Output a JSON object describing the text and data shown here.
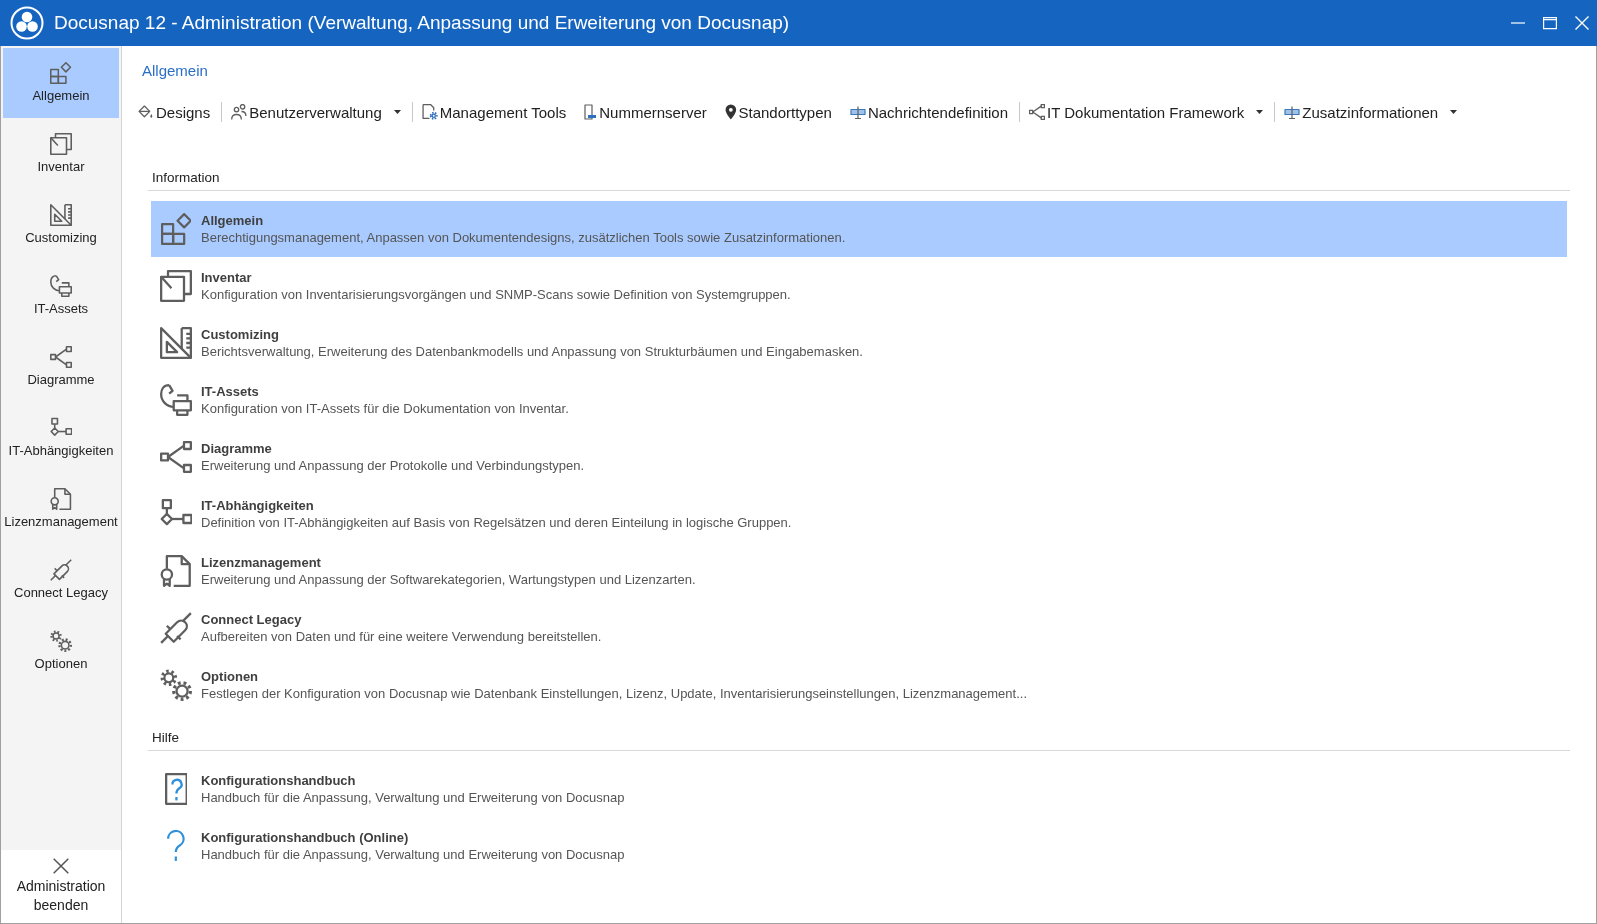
{
  "window": {
    "title": "Docusnap 12 - Administration (Verwaltung, Anpassung und Erweiterung von Docusnap)"
  },
  "sidebar": {
    "items": [
      {
        "label": "Allgemein",
        "kind": "tiles",
        "selected": true
      },
      {
        "label": "Inventar",
        "kind": "documents",
        "selected": false
      },
      {
        "label": "Customizing",
        "kind": "setsquare",
        "selected": false
      },
      {
        "label": "IT-Assets",
        "kind": "assets",
        "selected": false
      },
      {
        "label": "Diagramme",
        "kind": "diagram",
        "selected": false
      },
      {
        "label": "IT-Abhängigkeiten",
        "kind": "flowchart",
        "selected": false
      },
      {
        "label": "Lizenzmanagement",
        "kind": "certificate",
        "selected": false
      },
      {
        "label": "Connect Legacy",
        "kind": "plug",
        "selected": false
      },
      {
        "label": "Optionen",
        "kind": "gears",
        "selected": false
      }
    ],
    "exit": {
      "label": "Administration beenden"
    }
  },
  "page_title": "Allgemein",
  "toolbar": {
    "groups": [
      {
        "items": [
          {
            "label": "Designs",
            "kind": "bucket",
            "dropdown": false
          }
        ]
      },
      {
        "items": [
          {
            "label": "Benutzerverwaltung",
            "kind": "users",
            "dropdown": true
          }
        ]
      },
      {
        "items": [
          {
            "label": "Management Tools",
            "kind": "docgear",
            "dropdown": false
          },
          {
            "label": "Nummernserver",
            "kind": "numbers",
            "dropdown": false
          },
          {
            "label": "Standorttypen",
            "kind": "pin",
            "dropdown": false
          },
          {
            "label": "Nachrichtendefinition",
            "kind": "form",
            "dropdown": false
          }
        ]
      },
      {
        "items": [
          {
            "label": "IT Dokumentation Framework",
            "kind": "share",
            "dropdown": true
          }
        ]
      },
      {
        "items": [
          {
            "label": "Zusatzinformationen",
            "kind": "form",
            "dropdown": true
          }
        ]
      }
    ]
  },
  "sections": [
    {
      "heading": "Information",
      "items": [
        {
          "kind": "tiles",
          "title": "Allgemein",
          "description": "Berechtigungsmanagement, Anpassen von Dokumentendesigns, zusätzlichen Tools sowie Zusatzinformationen.",
          "selected": true
        },
        {
          "kind": "documents",
          "title": "Inventar",
          "description": "Konfiguration von Inventarisierungsvorgängen und SNMP-Scans sowie Definition von Systemgruppen.",
          "selected": false
        },
        {
          "kind": "setsquare",
          "title": "Customizing",
          "description": "Berichtsverwaltung, Erweiterung des Datenbankmodells und Anpassung von Strukturbäumen und Eingabemasken.",
          "selected": false
        },
        {
          "kind": "assets",
          "title": "IT-Assets",
          "description": "Konfiguration von IT-Assets für die Dokumentation von Inventar.",
          "selected": false
        },
        {
          "kind": "diagram",
          "title": "Diagramme",
          "description": "Erweiterung und Anpassung der Protokolle und Verbindungstypen.",
          "selected": false
        },
        {
          "kind": "flowchart",
          "title": "IT-Abhängigkeiten",
          "description": "Definition von IT-Abhängigkeiten auf Basis von Regelsätzen und deren Einteilung in logische Gruppen.",
          "selected": false
        },
        {
          "kind": "certificate",
          "title": "Lizenzmanagement",
          "description": "Erweiterung und Anpassung der Softwarekategorien, Wartungstypen und Lizenzarten.",
          "selected": false
        },
        {
          "kind": "plug",
          "title": "Connect Legacy",
          "description": "Aufbereiten von Daten und für eine weitere Verwendung bereitstellen.",
          "selected": false
        },
        {
          "kind": "gears",
          "title": "Optionen",
          "description": "Festlegen der Konfiguration von Docusnap wie Datenbank Einstellungen, Lizenz, Update, Inventarisierungseinstellungen, Lizenzmanagement...",
          "selected": false
        }
      ]
    },
    {
      "heading": "Hilfe",
      "items": [
        {
          "kind": "helpdoc",
          "title": "Konfigurationshandbuch",
          "description": "Handbuch für die Anpassung, Verwaltung und Erweiterung von Docusnap",
          "selected": false
        },
        {
          "kind": "question",
          "title": "Konfigurationshandbuch (Online)",
          "description": "Handbuch für die Anpassung, Verwaltung und Erweiterung von Docusnap",
          "selected": false
        }
      ]
    }
  ]
}
